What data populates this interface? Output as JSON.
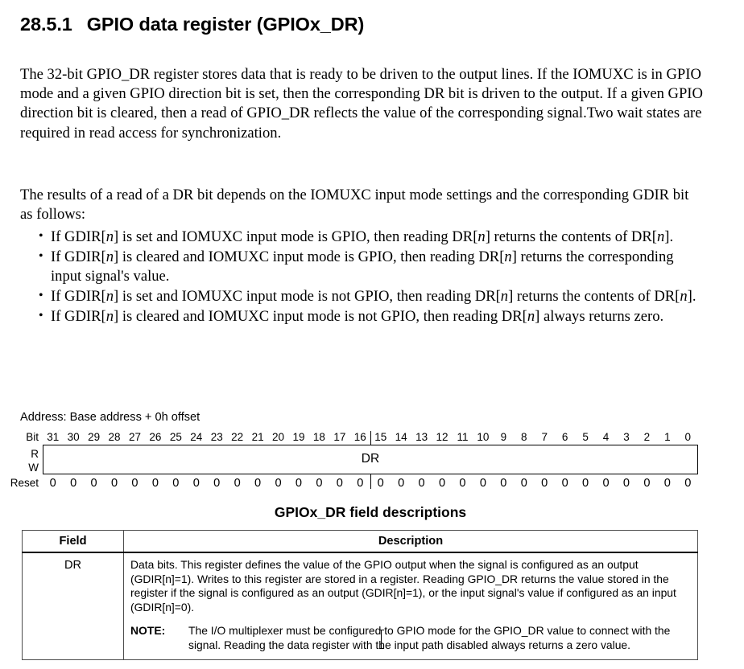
{
  "heading": {
    "number": "28.5.1",
    "title": "GPIO data register (GPIOx_DR)"
  },
  "paragraphs": {
    "intro": "The 32-bit GPIO_DR register stores data that is ready to be driven to the output lines. If the IOMUXC is in GPIO mode and a given GPIO direction bit is set, then the corresponding DR bit is driven to the output. If a given GPIO direction bit is cleared, then a read of GPIO_DR reflects the value of the corresponding signal.Two wait states are required in read access for synchronization.",
    "lead_in": "The results of a read of a DR bit depends on the IOMUXC input mode settings and the corresponding GDIR bit as follows:"
  },
  "bullets": [
    "If GDIR[n] is set and IOMUXC input mode is GPIO, then reading DR[n] returns the contents of DR[n].",
    "If GDIR[n] is cleared and IOMUXC input mode is GPIO, then reading DR[n] returns the corresponding input signal's value.",
    "If GDIR[n] is set and IOMUXC input mode is not GPIO, then reading DR[n] returns the contents of DR[n].",
    "If GDIR[n] is cleared and IOMUXC input mode is not GPIO, then reading DR[n] always returns zero."
  ],
  "register": {
    "address_line": "Address: Base address + 0h offset",
    "row_labels": {
      "bit": "Bit",
      "read": "R",
      "write": "W",
      "reset": "Reset"
    },
    "bits": [
      31,
      30,
      29,
      28,
      27,
      26,
      25,
      24,
      23,
      22,
      21,
      20,
      19,
      18,
      17,
      16,
      15,
      14,
      13,
      12,
      11,
      10,
      9,
      8,
      7,
      6,
      5,
      4,
      3,
      2,
      1,
      0
    ],
    "field_name": "DR",
    "reset_values": [
      "0",
      "0",
      "0",
      "0",
      "0",
      "0",
      "0",
      "0",
      "0",
      "0",
      "0",
      "0",
      "0",
      "0",
      "0",
      "0",
      "0",
      "0",
      "0",
      "0",
      "0",
      "0",
      "0",
      "0",
      "0",
      "0",
      "0",
      "0",
      "0",
      "0",
      "0",
      "0"
    ],
    "divider_after_bit": 16
  },
  "table": {
    "caption": "GPIOx_DR field descriptions",
    "headers": {
      "field": "Field",
      "description": "Description"
    },
    "rows": [
      {
        "field": "DR",
        "description": "Data bits. This register defines the value of the GPIO output when the signal is configured as an output (GDIR[n]=1). Writes to this register are stored in a register. Reading GPIO_DR returns the value stored in the register if the signal is configured as an output (GDIR[n]=1), or the input signal's value if configured as an input (GDIR[n]=0).",
        "note_label": "NOTE:",
        "note_text": "The I/O multiplexer must be configured to GPIO mode for the GPIO_DR value to connect with the signal. Reading the data register with the input path disabled always returns a zero value."
      }
    ]
  }
}
